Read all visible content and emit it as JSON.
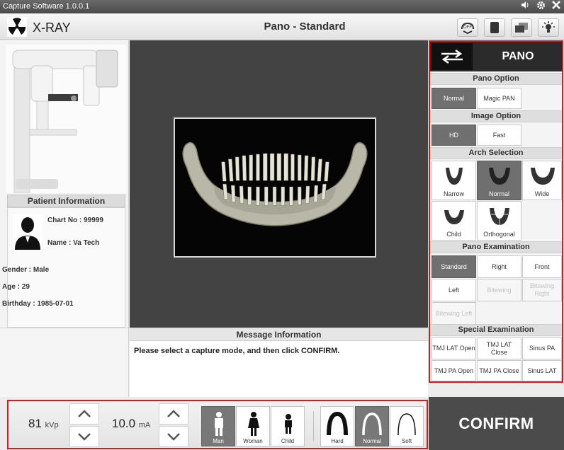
{
  "window": {
    "title": "Capture Software  1.0.0.1",
    "controls": [
      "speaker-icon",
      "gear-icon",
      "close-icon"
    ]
  },
  "header": {
    "app_name": "X-RAY",
    "mode_title": "Pano - Standard",
    "buttons": [
      "laser-off-icon",
      "sensor-icon",
      "layers-icon",
      "light-icon"
    ]
  },
  "patient": {
    "section_title": "Patient Information",
    "chart_no": "Chart No : 99999",
    "name": "Name : Va Tech",
    "gender": "Gender : Male",
    "age": "Age : 29",
    "birthday": "Birthday : 1985-07-01"
  },
  "message": {
    "title": "Message Information",
    "text": "Please select a capture mode, and then click CONFIRM."
  },
  "right_panel": {
    "mode_label": "PANO",
    "pano_option": {
      "title": "Pano Option",
      "options": [
        "Normal",
        "Magic PAN"
      ],
      "selected": "Normal"
    },
    "image_option": {
      "title": "Image Option",
      "options": [
        "HD",
        "Fast"
      ],
      "selected": "HD"
    },
    "arch_selection": {
      "title": "Arch Selection",
      "options": [
        "Narrow",
        "Normal",
        "Wide",
        "Child",
        "Orthogonal"
      ],
      "selected": "Normal"
    },
    "pano_examination": {
      "title": "Pano Examination",
      "options": [
        "Standard",
        "Right",
        "Front",
        "Left",
        "Bitewing",
        "Bitewing Right",
        "Bitewing Left"
      ],
      "selected": "Standard",
      "disabled": [
        "Bitewing",
        "Bitewing Right",
        "Bitewing Left"
      ]
    },
    "special_examination": {
      "title": "Special Examination",
      "options": [
        "TMJ LAT Open",
        "TMJ LAT Close",
        "Sinus PA",
        "TMJ PA Open",
        "TMJ PA Close",
        "Sinus LAT"
      ]
    }
  },
  "exposure": {
    "kvp_value": "81",
    "kvp_unit": "kVp",
    "ma_value": "10.0",
    "ma_unit": "mA",
    "patient_types": [
      "Man",
      "Woman",
      "Child"
    ],
    "patient_selected": "Man",
    "bone_density": [
      "Hard",
      "Normal",
      "Soft"
    ],
    "bone_selected": "Normal"
  },
  "confirm_label": "CONFIRM",
  "colors": {
    "highlight": "#d41c1c",
    "selected": "#707070",
    "dark_panel": "#2b2b2b"
  }
}
